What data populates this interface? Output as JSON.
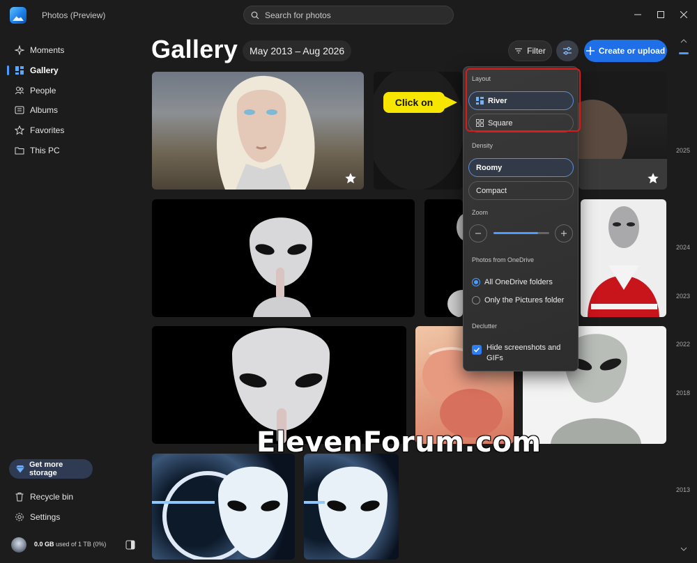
{
  "app": {
    "title": "Photos (Preview)"
  },
  "search": {
    "placeholder": "Search for photos"
  },
  "sidebar": {
    "items": [
      {
        "label": "Moments",
        "icon": "sparkle-icon"
      },
      {
        "label": "Gallery",
        "icon": "gallery-icon",
        "selected": true
      },
      {
        "label": "People",
        "icon": "people-icon"
      },
      {
        "label": "Albums",
        "icon": "albums-icon"
      },
      {
        "label": "Favorites",
        "icon": "star-icon"
      },
      {
        "label": "This PC",
        "icon": "folder-icon"
      }
    ],
    "storage_button": "Get more storage",
    "recycle_bin": "Recycle bin",
    "settings": "Settings",
    "storage_used": "0.0 GB",
    "storage_total": "used of 1 TB (0%)"
  },
  "header": {
    "title": "Gallery",
    "date_range": "May 2013 – Aug 2026",
    "filter_label": "Filter",
    "create_label": "Create or upload"
  },
  "timeline": {
    "years": [
      "2025",
      "2024",
      "2023",
      "2022",
      "2018",
      "2013"
    ]
  },
  "flyout": {
    "layout_heading": "Layout",
    "layout_options": [
      "River",
      "Square"
    ],
    "density_heading": "Density",
    "density_options": [
      "Roomy",
      "Compact"
    ],
    "zoom_heading": "Zoom",
    "zoom_level": 0.8,
    "onedrive_heading": "Photos from OneDrive",
    "onedrive_options": [
      "All OneDrive folders",
      "Only the Pictures folder"
    ],
    "declutter_heading": "Declutter",
    "declutter_option": "Hide screenshots and GIFs",
    "declutter_checked": true
  },
  "annotation": {
    "callout": "Click on"
  },
  "watermark": "ElevenForum.com",
  "colors": {
    "accent": "#1f6fe8",
    "highlight": "#e01818",
    "callout": "#f7e600"
  }
}
